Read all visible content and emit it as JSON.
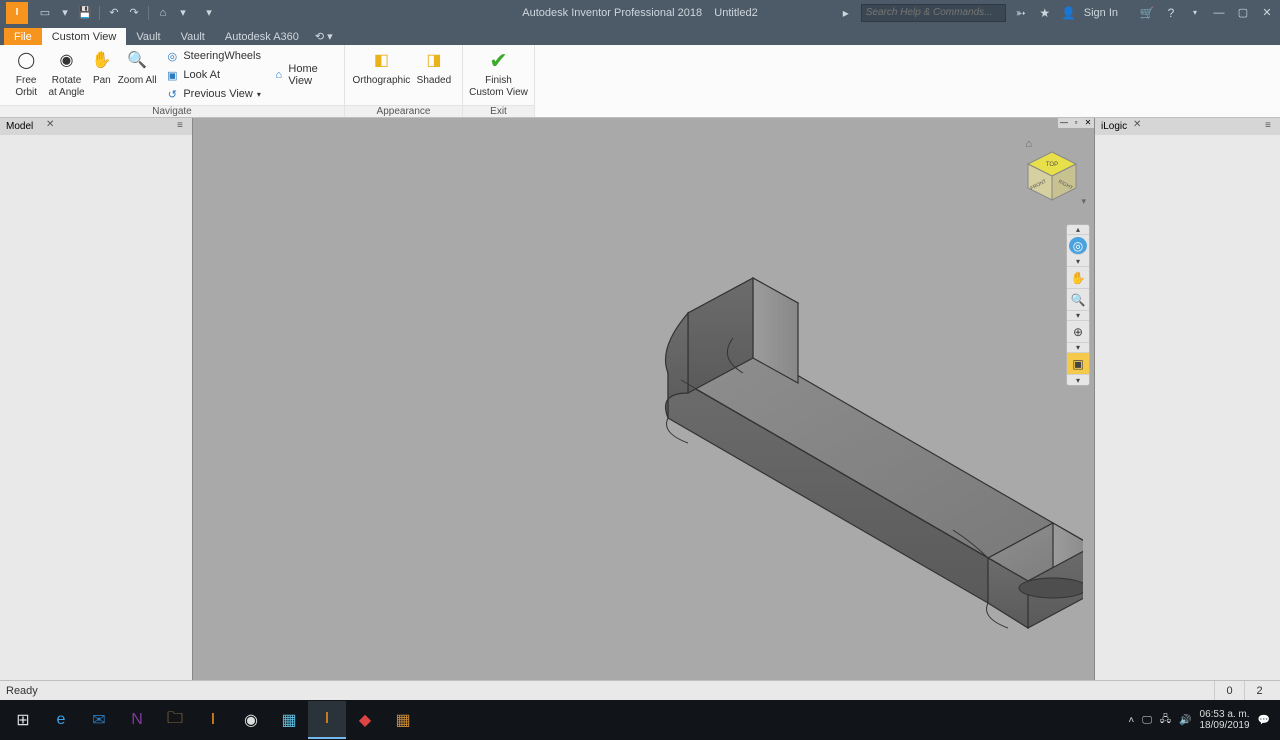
{
  "app": {
    "title": "Autodesk Inventor Professional 2018",
    "document": "Untitled2"
  },
  "titlebar": {
    "search_placeholder": "Search Help & Commands...",
    "signin": "Sign In"
  },
  "tabs": {
    "file": "File",
    "custom_view": "Custom View",
    "vault1": "Vault",
    "vault2": "Vault",
    "a360": "Autodesk A360"
  },
  "ribbon": {
    "navigate": {
      "label": "Navigate",
      "free_orbit": "Free Orbit",
      "rotate_at_angle": "Rotate at Angle",
      "pan": "Pan",
      "zoom_all": "Zoom All",
      "steering_wheels": "SteeringWheels",
      "look_at": "Look At",
      "previous_view": "Previous View",
      "home_view": "Home View"
    },
    "appearance": {
      "label": "Appearance",
      "orthographic": "Orthographic",
      "shaded": "Shaded"
    },
    "exit": {
      "label": "Exit",
      "finish": "Finish Custom View"
    }
  },
  "panels": {
    "model": "Model",
    "ilogic": "iLogic"
  },
  "viewcube": {
    "top": "TOP",
    "front": "FRONT",
    "right": "RIGHT"
  },
  "status": {
    "ready": "Ready",
    "n0": "0",
    "n2": "2"
  },
  "taskbar": {
    "time": "06:53 a. m.",
    "date": "18/09/2019"
  }
}
